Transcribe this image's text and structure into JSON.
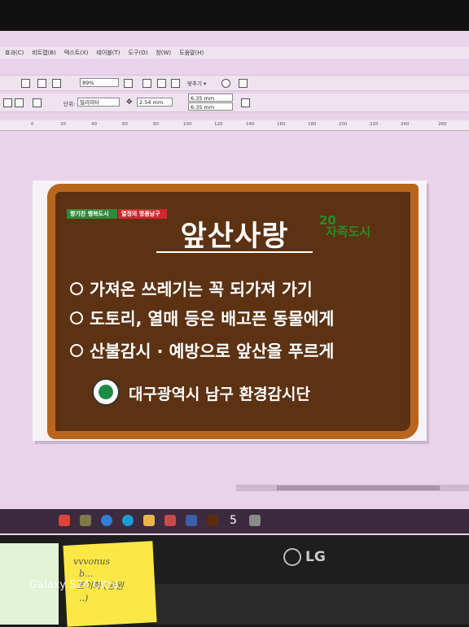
{
  "menu": [
    "효과(C)",
    "비트맵(B)",
    "텍스트(X)",
    "테이블(T)",
    "도구(O)",
    "창(W)",
    "도움말(H)"
  ],
  "toolbar": {
    "zoom_value": "89%",
    "fit_label": "맞추기 ▾",
    "unit_label": "단위:",
    "unit_value": "밀리미터",
    "nudge_value": "2.54 mm",
    "dup_x": "6.35 mm",
    "dup_y": "6.35 mm"
  },
  "ruler_ticks": [
    "0",
    "20",
    "40",
    "60",
    "80",
    "100",
    "120",
    "140",
    "160",
    "180",
    "200",
    "220",
    "240",
    "260"
  ],
  "sign": {
    "tag_left": "향기찬 행복도시",
    "tag_right": "열정의 명품남구",
    "title": "앞산사랑",
    "anniversary_num": "20",
    "anniversary_text": "자족도시",
    "lines": [
      "가져온 쓰레기는 꼭 되가져 가기",
      "도토리, 열매 등은 배고픈 동물에게",
      "산불감시 · 예방으로 앞산을 푸르게"
    ],
    "agency": "대구광역시 남구 환경감시단"
  },
  "taskbar_text": "5",
  "monitor_brand": "LG",
  "sticky_note_text": "vvvonus\n  b...\n 조이화 (공원\n  ..)",
  "camera_watermark": "Galaxy S24 Ultra",
  "colors": {
    "screen_bg": "#ead3ea",
    "sign_wood": "#5a3112",
    "sign_border": "#b8651d",
    "tag_green": "#2e8b3a",
    "tag_red": "#d0262e",
    "anniversary_green": "#2b8a2b"
  }
}
